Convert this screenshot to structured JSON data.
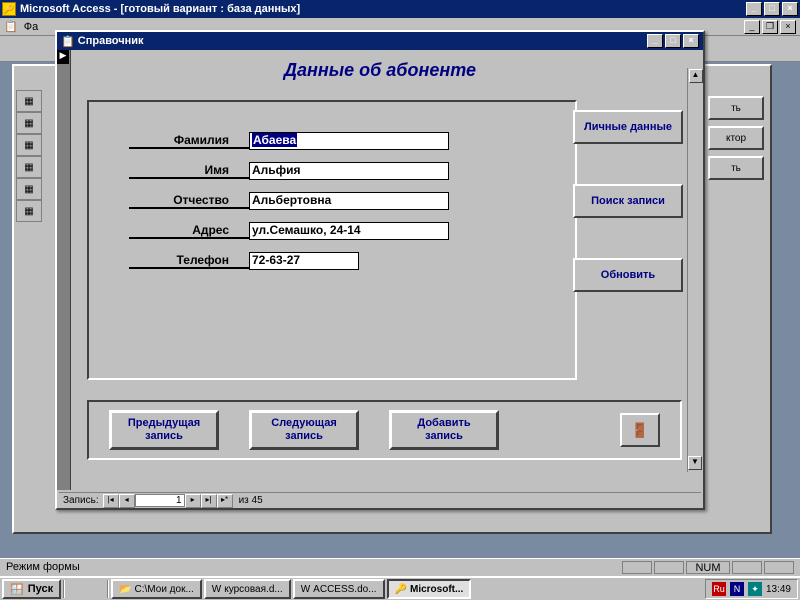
{
  "app": {
    "title": "Microsoft Access - [готовый вариант : база данных]"
  },
  "menubar": {
    "file": "Фа"
  },
  "db_window": {
    "side_buttons": [
      "ть",
      "ктор",
      "ть"
    ]
  },
  "form": {
    "title": "Справочник",
    "heading": "Данные об абоненте",
    "labels": {
      "surname": "Фамилия",
      "name": "Имя",
      "patronymic": "Отчество",
      "address": "Адрес",
      "phone": "Телефон"
    },
    "values": {
      "surname": "Абаева",
      "name": "Альфия",
      "patronymic": "Альбертовна",
      "address": "ул.Семашко, 24-14",
      "phone": "72-63-27"
    },
    "right_buttons": {
      "personal": "Личные данные",
      "search": "Поиск записи",
      "refresh": "Обновить"
    },
    "bottom_buttons": {
      "prev": "Предыдущая запись",
      "next": "Следующая запись",
      "add": "Добавить запись"
    },
    "record_nav": {
      "label": "Запись:",
      "current": "1",
      "of_text": "из 45"
    }
  },
  "statusbar": {
    "mode": "Режим формы",
    "num": "NUM"
  },
  "taskbar": {
    "start": "Пуск",
    "items": [
      "С:\\Мои док...",
      "курсовая.d...",
      "ACCESS.do...",
      "Microsoft..."
    ],
    "tray": {
      "lang": "Ru",
      "time": "13:49"
    }
  }
}
